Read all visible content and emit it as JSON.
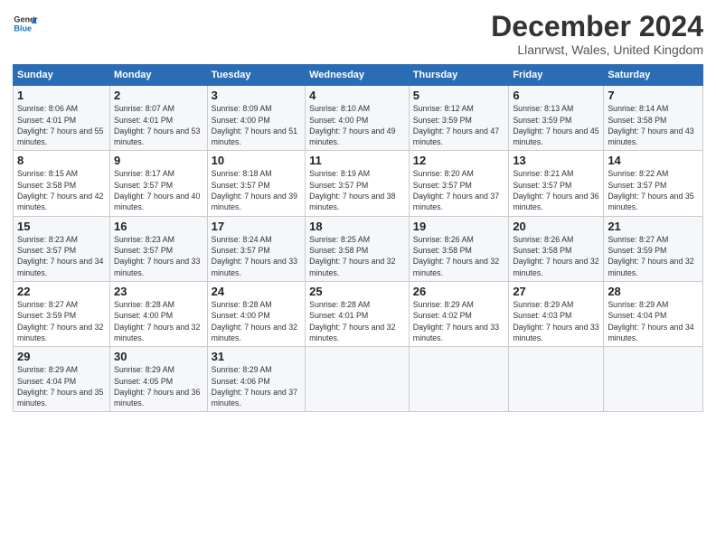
{
  "header": {
    "logo_line1": "General",
    "logo_line2": "Blue",
    "title": "December 2024",
    "subtitle": "Llanrwst, Wales, United Kingdom"
  },
  "weekdays": [
    "Sunday",
    "Monday",
    "Tuesday",
    "Wednesday",
    "Thursday",
    "Friday",
    "Saturday"
  ],
  "weeks": [
    [
      {
        "day": "1",
        "sunrise": "Sunrise: 8:06 AM",
        "sunset": "Sunset: 4:01 PM",
        "daylight": "Daylight: 7 hours and 55 minutes."
      },
      {
        "day": "2",
        "sunrise": "Sunrise: 8:07 AM",
        "sunset": "Sunset: 4:01 PM",
        "daylight": "Daylight: 7 hours and 53 minutes."
      },
      {
        "day": "3",
        "sunrise": "Sunrise: 8:09 AM",
        "sunset": "Sunset: 4:00 PM",
        "daylight": "Daylight: 7 hours and 51 minutes."
      },
      {
        "day": "4",
        "sunrise": "Sunrise: 8:10 AM",
        "sunset": "Sunset: 4:00 PM",
        "daylight": "Daylight: 7 hours and 49 minutes."
      },
      {
        "day": "5",
        "sunrise": "Sunrise: 8:12 AM",
        "sunset": "Sunset: 3:59 PM",
        "daylight": "Daylight: 7 hours and 47 minutes."
      },
      {
        "day": "6",
        "sunrise": "Sunrise: 8:13 AM",
        "sunset": "Sunset: 3:59 PM",
        "daylight": "Daylight: 7 hours and 45 minutes."
      },
      {
        "day": "7",
        "sunrise": "Sunrise: 8:14 AM",
        "sunset": "Sunset: 3:58 PM",
        "daylight": "Daylight: 7 hours and 43 minutes."
      }
    ],
    [
      {
        "day": "8",
        "sunrise": "Sunrise: 8:15 AM",
        "sunset": "Sunset: 3:58 PM",
        "daylight": "Daylight: 7 hours and 42 minutes."
      },
      {
        "day": "9",
        "sunrise": "Sunrise: 8:17 AM",
        "sunset": "Sunset: 3:57 PM",
        "daylight": "Daylight: 7 hours and 40 minutes."
      },
      {
        "day": "10",
        "sunrise": "Sunrise: 8:18 AM",
        "sunset": "Sunset: 3:57 PM",
        "daylight": "Daylight: 7 hours and 39 minutes."
      },
      {
        "day": "11",
        "sunrise": "Sunrise: 8:19 AM",
        "sunset": "Sunset: 3:57 PM",
        "daylight": "Daylight: 7 hours and 38 minutes."
      },
      {
        "day": "12",
        "sunrise": "Sunrise: 8:20 AM",
        "sunset": "Sunset: 3:57 PM",
        "daylight": "Daylight: 7 hours and 37 minutes."
      },
      {
        "day": "13",
        "sunrise": "Sunrise: 8:21 AM",
        "sunset": "Sunset: 3:57 PM",
        "daylight": "Daylight: 7 hours and 36 minutes."
      },
      {
        "day": "14",
        "sunrise": "Sunrise: 8:22 AM",
        "sunset": "Sunset: 3:57 PM",
        "daylight": "Daylight: 7 hours and 35 minutes."
      }
    ],
    [
      {
        "day": "15",
        "sunrise": "Sunrise: 8:23 AM",
        "sunset": "Sunset: 3:57 PM",
        "daylight": "Daylight: 7 hours and 34 minutes."
      },
      {
        "day": "16",
        "sunrise": "Sunrise: 8:23 AM",
        "sunset": "Sunset: 3:57 PM",
        "daylight": "Daylight: 7 hours and 33 minutes."
      },
      {
        "day": "17",
        "sunrise": "Sunrise: 8:24 AM",
        "sunset": "Sunset: 3:57 PM",
        "daylight": "Daylight: 7 hours and 33 minutes."
      },
      {
        "day": "18",
        "sunrise": "Sunrise: 8:25 AM",
        "sunset": "Sunset: 3:58 PM",
        "daylight": "Daylight: 7 hours and 32 minutes."
      },
      {
        "day": "19",
        "sunrise": "Sunrise: 8:26 AM",
        "sunset": "Sunset: 3:58 PM",
        "daylight": "Daylight: 7 hours and 32 minutes."
      },
      {
        "day": "20",
        "sunrise": "Sunrise: 8:26 AM",
        "sunset": "Sunset: 3:58 PM",
        "daylight": "Daylight: 7 hours and 32 minutes."
      },
      {
        "day": "21",
        "sunrise": "Sunrise: 8:27 AM",
        "sunset": "Sunset: 3:59 PM",
        "daylight": "Daylight: 7 hours and 32 minutes."
      }
    ],
    [
      {
        "day": "22",
        "sunrise": "Sunrise: 8:27 AM",
        "sunset": "Sunset: 3:59 PM",
        "daylight": "Daylight: 7 hours and 32 minutes."
      },
      {
        "day": "23",
        "sunrise": "Sunrise: 8:28 AM",
        "sunset": "Sunset: 4:00 PM",
        "daylight": "Daylight: 7 hours and 32 minutes."
      },
      {
        "day": "24",
        "sunrise": "Sunrise: 8:28 AM",
        "sunset": "Sunset: 4:00 PM",
        "daylight": "Daylight: 7 hours and 32 minutes."
      },
      {
        "day": "25",
        "sunrise": "Sunrise: 8:28 AM",
        "sunset": "Sunset: 4:01 PM",
        "daylight": "Daylight: 7 hours and 32 minutes."
      },
      {
        "day": "26",
        "sunrise": "Sunrise: 8:29 AM",
        "sunset": "Sunset: 4:02 PM",
        "daylight": "Daylight: 7 hours and 33 minutes."
      },
      {
        "day": "27",
        "sunrise": "Sunrise: 8:29 AM",
        "sunset": "Sunset: 4:03 PM",
        "daylight": "Daylight: 7 hours and 33 minutes."
      },
      {
        "day": "28",
        "sunrise": "Sunrise: 8:29 AM",
        "sunset": "Sunset: 4:04 PM",
        "daylight": "Daylight: 7 hours and 34 minutes."
      }
    ],
    [
      {
        "day": "29",
        "sunrise": "Sunrise: 8:29 AM",
        "sunset": "Sunset: 4:04 PM",
        "daylight": "Daylight: 7 hours and 35 minutes."
      },
      {
        "day": "30",
        "sunrise": "Sunrise: 8:29 AM",
        "sunset": "Sunset: 4:05 PM",
        "daylight": "Daylight: 7 hours and 36 minutes."
      },
      {
        "day": "31",
        "sunrise": "Sunrise: 8:29 AM",
        "sunset": "Sunset: 4:06 PM",
        "daylight": "Daylight: 7 hours and 37 minutes."
      },
      null,
      null,
      null,
      null
    ]
  ]
}
